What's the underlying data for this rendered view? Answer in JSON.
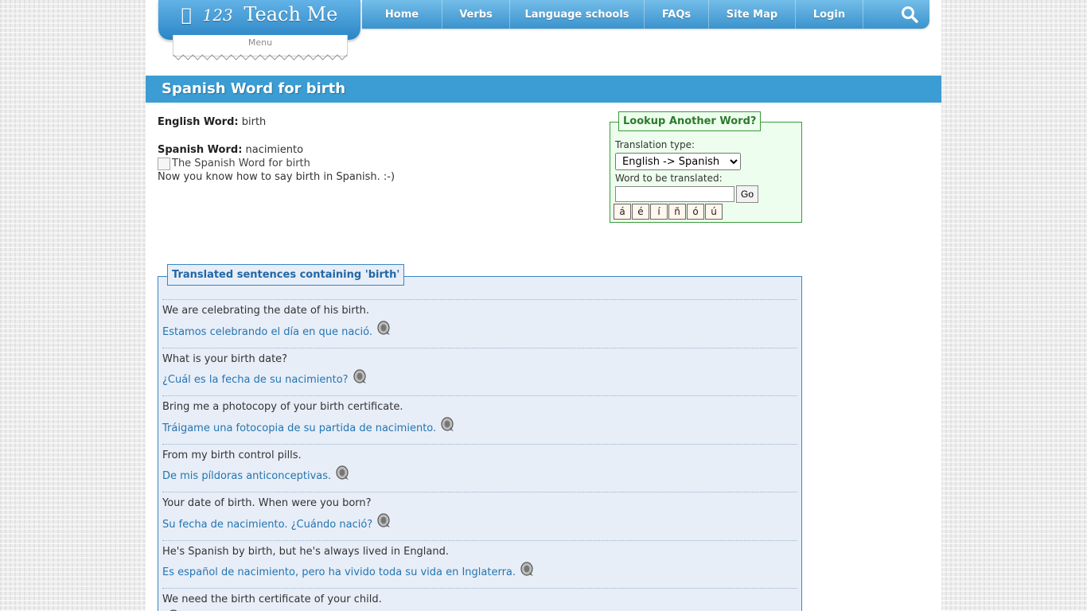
{
  "logo": {
    "brand": "123 Teach Me",
    "num": "123",
    "name": "Teach Me",
    "menu_label": "Menu"
  },
  "nav": [
    "Home",
    "Verbs",
    "Language schools",
    "FAQs",
    "Site Map",
    "Login"
  ],
  "title": "Spanish Word for birth",
  "word": {
    "english_label": "English Word:",
    "english_value": "birth",
    "spanish_label": "Spanish Word:",
    "spanish_value": "nacimiento",
    "image_alt": "The Spanish Word for birth",
    "note": "Now you know how to say birth in Spanish. :-)"
  },
  "lookup": {
    "legend": "Lookup Another Word?",
    "type_label": "Translation type:",
    "type_value": "English -> Spanish",
    "word_label": "Word to be translated:",
    "go_label": "Go",
    "accents": [
      "á",
      "é",
      "í",
      "ñ",
      "ó",
      "ú"
    ]
  },
  "sentences": {
    "legend": "Translated sentences containing 'birth'",
    "items": [
      {
        "en": "We are celebrating the date of his birth.",
        "es": "Estamos celebrando el día en que nació."
      },
      {
        "en": "What is your birth date?",
        "es": "¿Cuál es la fecha de su nacimiento?"
      },
      {
        "en": "Bring me a photocopy of your birth certificate.",
        "es": "Tráigame una fotocopia de su partida de nacimiento."
      },
      {
        "en": "From my birth control pills.",
        "es": "De mis píldoras anticonceptivas."
      },
      {
        "en": "Your date of birth. When were you born?",
        "es": "Su fecha de nacimiento. ¿Cuándo nació?"
      },
      {
        "en": "He's Spanish by birth, but he's always lived in England.",
        "es": "Es español de nacimiento, pero ha vivido toda su vida en Inglaterra."
      },
      {
        "en": "We need the birth certificate of your child.",
        "es": ""
      }
    ]
  },
  "colors": {
    "accent_blue": "#3b9dd3",
    "lookup_green": "#3b9a3b",
    "link_blue": "#2574b0"
  }
}
